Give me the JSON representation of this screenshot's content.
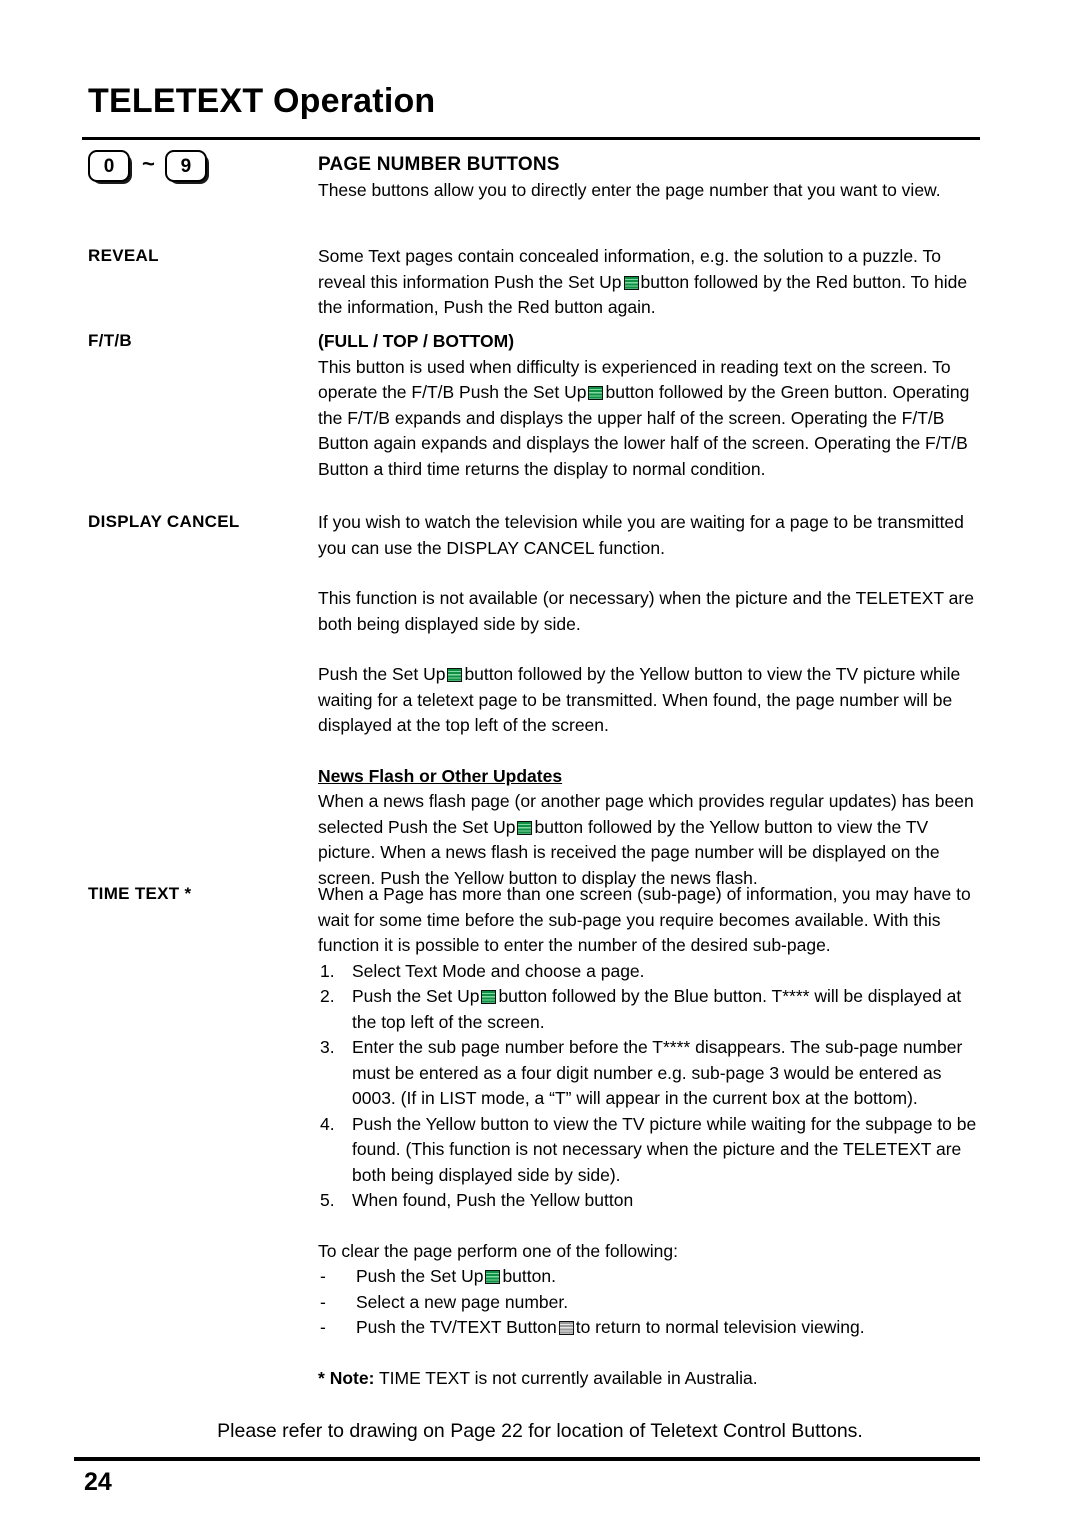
{
  "page": {
    "title": "TELETEXT Operation",
    "page_number": "24",
    "footer_note": "Please refer to drawing on Page 22 for location of Teletext Control Buttons."
  },
  "icons": {
    "setup_button": "setup-button-icon",
    "tvtext_button": "tvtext-button-icon",
    "green_color": "#0f8f42",
    "grey_color": "#9a9a9a"
  },
  "keys": {
    "first": "0",
    "separator": "~",
    "last": "9"
  },
  "sections": {
    "page_number_buttons": {
      "heading": "PAGE NUMBER BUTTONS",
      "body": "These buttons allow you to directly enter the page number that you want to view."
    },
    "reveal": {
      "label": "REVEAL",
      "part1": "Some Text pages contain concealed information, e.g. the solution to a puzzle. To reveal this information Push the Set Up",
      "part2": "button followed by the Red button. To hide the information, Push the Red button again."
    },
    "ftb": {
      "label": "F/T/B",
      "heading": "(FULL / TOP / BOTTOM)",
      "part1": "This button is used when difficulty is experienced in reading text on the screen. To operate the F/T/B Push the Set Up",
      "part2": "button followed by the Green button. Operating the F/T/B expands and displays the upper half of the screen. Operating the F/T/B Button again expands and displays the lower half of the screen. Operating the F/T/B Button a third time returns the display to normal condition."
    },
    "display_cancel": {
      "label": "DISPLAY CANCEL",
      "para1": "If you wish to watch the television while you are waiting for a page to be transmitted you can use the DISPLAY CANCEL function.",
      "para2": "This function is not available (or necessary) when the picture and the TELETEXT are both being displayed side by side.",
      "para3_part1": "Push the Set Up",
      "para3_part2": "button followed by the Yellow button to view the TV picture while waiting for a teletext page to be transmitted. When found, the page number will be displayed at the top left of the screen.",
      "news_flash_heading": "News Flash or Other Updates",
      "news_flash_part1": "When a news flash page (or another page which provides regular updates) has been selected Push the Set Up",
      "news_flash_part2": "button followed by the Yellow button  to view the TV picture. When a news flash is received the page number will be displayed on the screen. Push the Yellow button to display the news flash."
    },
    "time_text": {
      "label": "TIME TEXT *",
      "intro": "When a Page has more than one screen (sub-page) of information, you may have to wait for some time before the sub-page you require becomes available. With this function it is possible to enter the number of the desired sub-page.",
      "steps": [
        {
          "num": "1.",
          "text": "Select Text Mode and choose a page."
        },
        {
          "num": "2.",
          "text_part1": "Push the Set Up",
          "text_part2": "button followed by the Blue button. T**** will be displayed at the top left of the screen."
        },
        {
          "num": "3.",
          "text": "Enter the sub page number before the T**** disappears. The sub-page number must be entered as a four digit number e.g. sub-page 3 would be entered as 0003. (If in LIST mode, a “T” will appear in the current box at the bottom)."
        },
        {
          "num": "4.",
          "text": "Push the Yellow button to view the TV picture while waiting for the subpage to be found. (This function is not necessary when the picture and the TELETEXT are both being displayed side by side)."
        },
        {
          "num": "5.",
          "text": "When found, Push the Yellow button"
        }
      ],
      "clear_intro": "To clear the page perform one of the following:",
      "clear_items": [
        {
          "dash": "-",
          "text_part1": "Push the Set Up",
          "text_part2": "button."
        },
        {
          "dash": "-",
          "text": "Select a new page number."
        },
        {
          "dash": "-",
          "text_part1": "Push the TV/TEXT Button",
          "text_part2": "to return to normal television viewing."
        }
      ],
      "note_star": "*",
      "note_label": "Note:",
      "note_text": "TIME TEXT is not currently available in Australia."
    }
  }
}
